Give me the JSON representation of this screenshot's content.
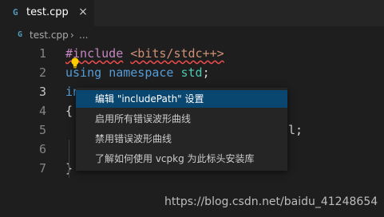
{
  "tab": {
    "label": "test.cpp",
    "icon": "cpp-file-icon",
    "close": "×"
  },
  "breadcrumb": {
    "file": "test.cpp",
    "separator": "›",
    "more": "..."
  },
  "editor": {
    "line_numbers": [
      "1",
      "2",
      "3",
      "4",
      "5",
      "6",
      "7"
    ],
    "lines": {
      "l1_directive": "#include",
      "l1_header": "<bits/stdc++>",
      "l2_using": "using",
      "l2_namespace": "namespace",
      "l2_std": "std",
      "l2_semicolon": ";",
      "l3_partial": "in",
      "l4_brace": "{",
      "l5_tail": "l;",
      "l7_brace": "}"
    }
  },
  "quick_fix_menu": {
    "items": [
      "编辑 \"includePath\" 设置",
      "启用所有错误波形曲线",
      "禁用错误波形曲线",
      "了解如何使用 vcpkg 为此标头安装库"
    ],
    "selected_index": 0
  },
  "watermark": "https://blog.csdn.net/baidu_41248654",
  "colors": {
    "editor_bg": "#1e1e1e",
    "menu_bg": "#252526",
    "menu_selected": "#094771",
    "error_squiggle": "#f14c4c",
    "lightbulb": "#ffcc00"
  }
}
